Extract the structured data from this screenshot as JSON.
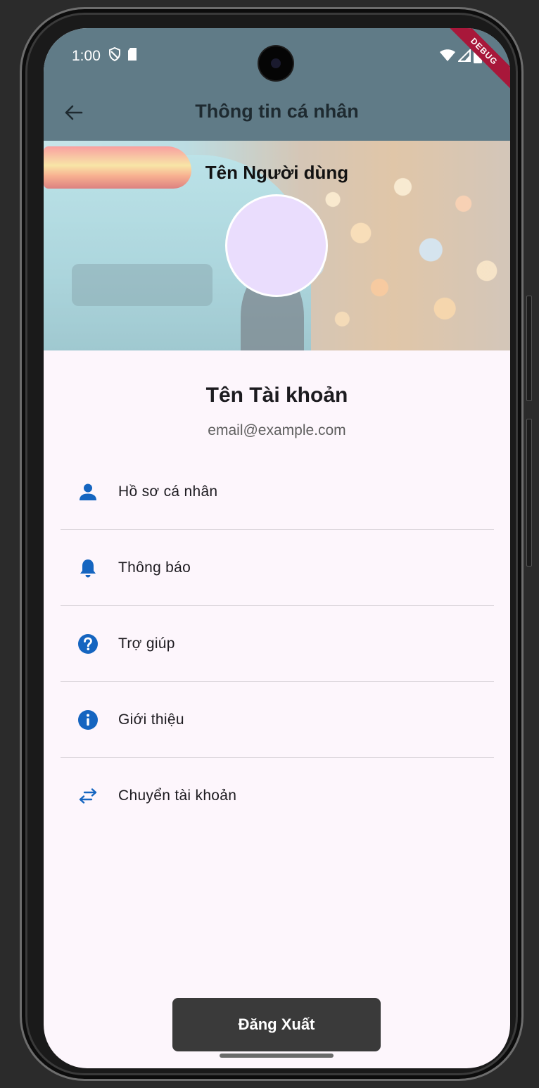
{
  "status_bar": {
    "time": "1:00"
  },
  "debug_label": "DEBUG",
  "app_bar": {
    "title": "Thông tin cá nhân"
  },
  "hero": {
    "user_name": "Tên Người dùng"
  },
  "account": {
    "name": "Tên Tài khoản",
    "email": "email@example.com"
  },
  "menu": {
    "items": [
      {
        "label": "Hồ sơ cá nhân",
        "icon": "person-icon"
      },
      {
        "label": "Thông báo",
        "icon": "bell-icon"
      },
      {
        "label": "Trợ giúp",
        "icon": "help-icon"
      },
      {
        "label": "Giới thiệu",
        "icon": "info-icon"
      },
      {
        "label": "Chuyển tài khoản",
        "icon": "swap-icon"
      }
    ]
  },
  "logout": {
    "label": "Đăng Xuất"
  },
  "colors": {
    "app_bar": "#607b87",
    "icon_blue": "#1565c0",
    "background": "#fdf6fc",
    "avatar": "#eaddfd",
    "button": "#3a3a3a"
  }
}
